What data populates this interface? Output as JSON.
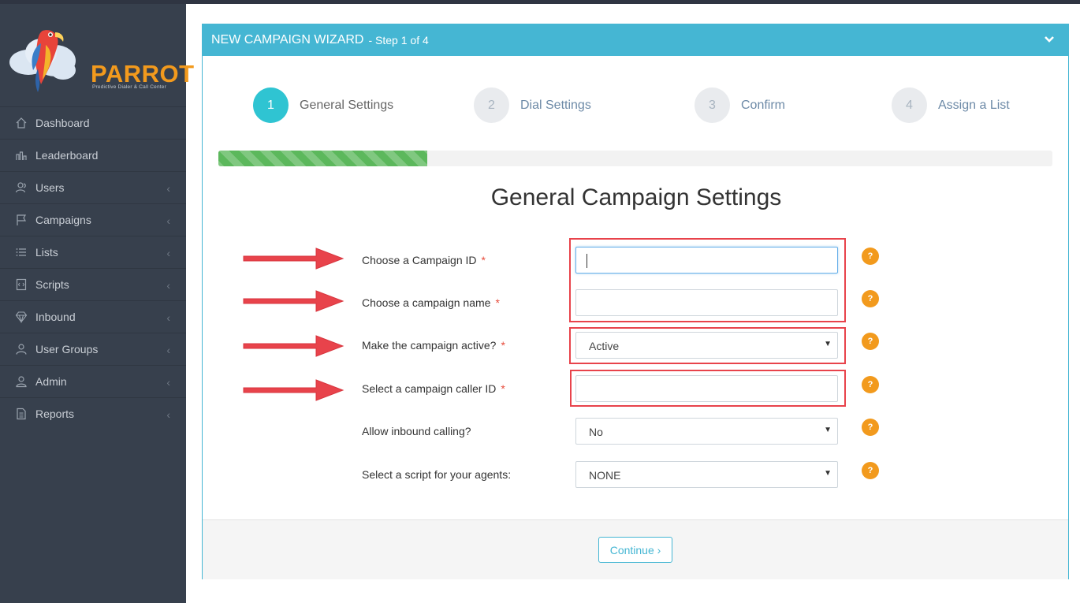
{
  "brand": {
    "name": "PARROT",
    "tagline": "Predictive Dialer & Call Center"
  },
  "sidebar": {
    "items": [
      {
        "label": "Dashboard",
        "icon": "home-icon",
        "has_submenu": false
      },
      {
        "label": "Leaderboard",
        "icon": "bar-chart-icon",
        "has_submenu": false
      },
      {
        "label": "Users",
        "icon": "users-icon",
        "has_submenu": true
      },
      {
        "label": "Campaigns",
        "icon": "flag-icon",
        "has_submenu": true
      },
      {
        "label": "Lists",
        "icon": "list-icon",
        "has_submenu": true
      },
      {
        "label": "Scripts",
        "icon": "script-icon",
        "has_submenu": true
      },
      {
        "label": "Inbound",
        "icon": "diamond-icon",
        "has_submenu": true
      },
      {
        "label": "User Groups",
        "icon": "user-groups-icon",
        "has_submenu": true
      },
      {
        "label": "Admin",
        "icon": "admin-icon",
        "has_submenu": true
      },
      {
        "label": "Reports",
        "icon": "reports-icon",
        "has_submenu": true
      }
    ]
  },
  "wizard": {
    "title": "NEW CAMPAIGN WIZARD",
    "step_text": "- Step 1 of 4",
    "steps": [
      {
        "number": "1",
        "label": "General Settings",
        "active": true
      },
      {
        "number": "2",
        "label": "Dial Settings",
        "active": false
      },
      {
        "number": "3",
        "label": "Confirm",
        "active": false
      },
      {
        "number": "4",
        "label": "Assign a List",
        "active": false
      }
    ],
    "progress": 0.25,
    "section_title": "General Campaign Settings",
    "fields": {
      "campaign_id": {
        "label": "Choose a Campaign ID",
        "required": "*",
        "value": ""
      },
      "campaign_name": {
        "label": "Choose a campaign name",
        "required": "*",
        "value": ""
      },
      "active": {
        "label": "Make the campaign active?",
        "required": "*",
        "value": "Active"
      },
      "caller_id": {
        "label": "Select a campaign caller ID",
        "required": "*",
        "value": ""
      },
      "inbound": {
        "label": "Allow inbound calling?",
        "value": "No"
      },
      "script": {
        "label": "Select a script for your agents:",
        "value": "NONE"
      }
    },
    "help_symbol": "?",
    "continue_label": "Continue ›"
  },
  "colors": {
    "accent": "#45b6d3",
    "sidebar": "#37404d",
    "brand": "#f29a1d",
    "progress": "#5cb85c",
    "highlight": "#e8434b"
  }
}
